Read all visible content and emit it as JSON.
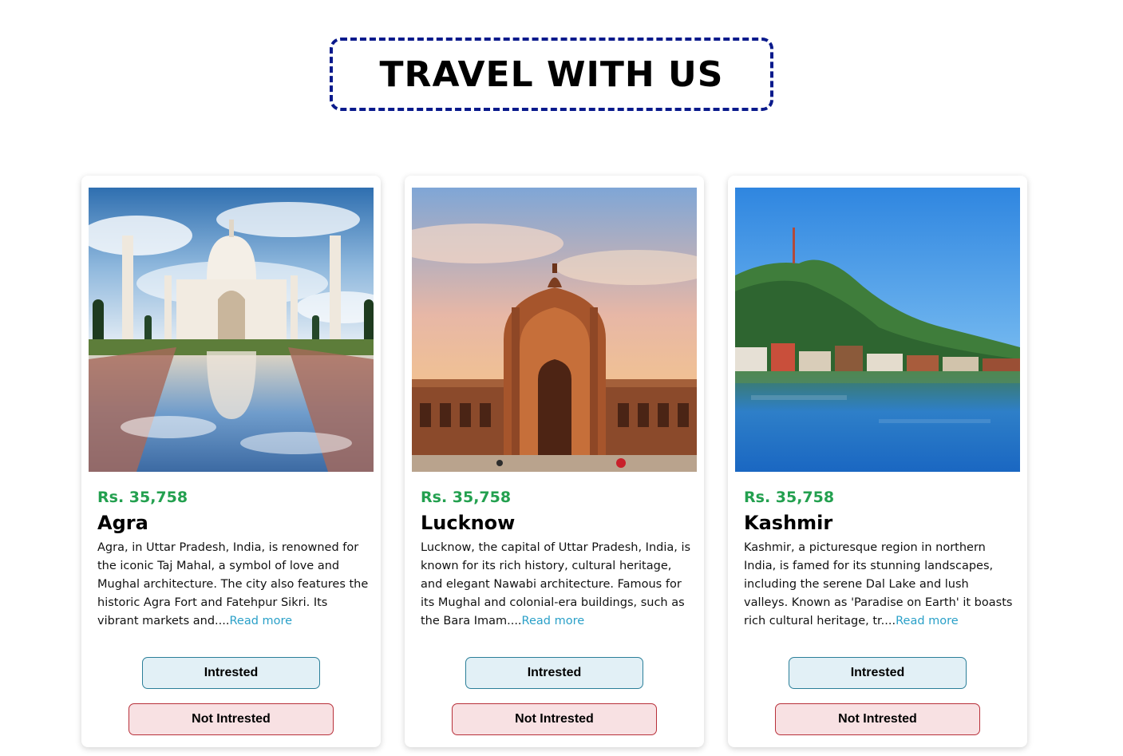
{
  "header": {
    "title": "TRAVEL WITH US"
  },
  "cards": [
    {
      "price": "Rs. 35,758",
      "city": "Agra",
      "description": "Agra, in Uttar Pradesh, India, is renowned for the iconic Taj Mahal, a symbol of love and Mughal architecture. The city also features the historic Agra Fort and Fatehpur Sikri. Its vibrant markets and....",
      "read_more": "Read more",
      "interested_label": "Intrested",
      "not_interested_label": "Not Intrested",
      "image": "taj-mahal-image"
    },
    {
      "price": "Rs. 35,758",
      "city": "Lucknow",
      "description": "Lucknow, the capital of Uttar Pradesh, India, is known for its rich history, cultural heritage, and elegant Nawabi architecture. Famous for its Mughal and colonial-era buildings, such as the Bara Imam....",
      "read_more": "Read more",
      "interested_label": "Intrested",
      "not_interested_label": "Not Intrested",
      "image": "rumi-darwaza-image"
    },
    {
      "price": "Rs. 35,758",
      "city": "Kashmir",
      "description": "Kashmir, a picturesque region in northern India, is famed for its stunning landscapes, including the serene Dal Lake and lush valleys. Known as 'Paradise on Earth' it boasts rich cultural heritage, tr....",
      "read_more": "Read more",
      "interested_label": "Intrested",
      "not_interested_label": "Not Intrested",
      "image": "dal-lake-image"
    }
  ],
  "colors": {
    "price": "#23a04f",
    "read_more": "#2aa0c8",
    "title_border": "#0a1a8c",
    "interested_bg": "#e2f0f6",
    "interested_border": "#2b7f99",
    "not_interested_bg": "#f8e1e3",
    "not_interested_border": "#b8303a"
  }
}
